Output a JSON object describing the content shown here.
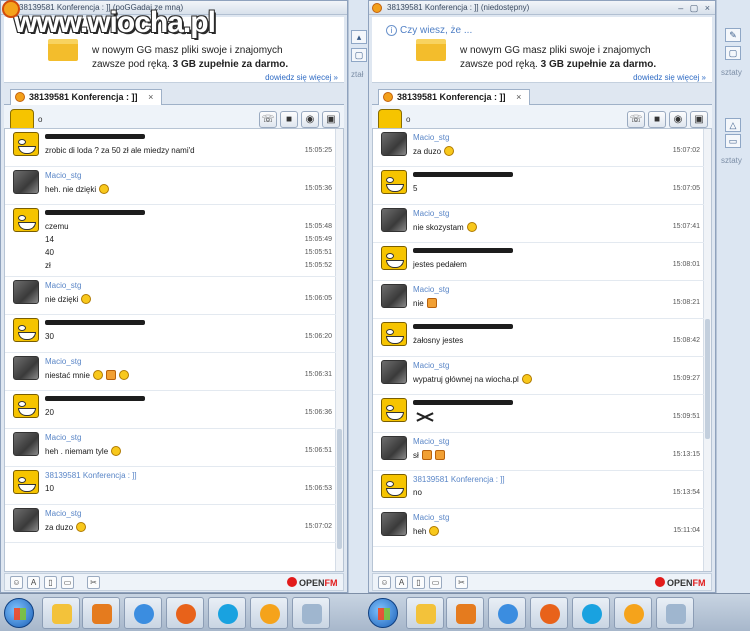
{
  "logo": {
    "text": "www.wiocha.pl"
  },
  "left_window": {
    "title": "38139581 Konferencja : ]] (poGGadaj ze mną)",
    "banner": {
      "line1": "w nowym GG masz pliki swoje i znajomych",
      "line2_pre": "zawsze pod ręką. ",
      "line2_bold": "3 GB zupełnie za darmo.",
      "more_link": "dowiedz się więcej »"
    },
    "tab_label": "38139581 Konferencja : ]]",
    "tab_close": "×",
    "status": "o",
    "messages": [
      {
        "avatar": "smile",
        "nick": "",
        "censored": true,
        "lines": [
          {
            "text": "zrobic di loda ? za 50 zł ale miedzy nami'd",
            "time": "15:05:25"
          }
        ]
      },
      {
        "avatar": "photo",
        "nick": "Macio_stg",
        "censored": false,
        "lines": [
          {
            "text": "heh. nie dzięki",
            "time": "15:05:36",
            "emo": [
              "round"
            ]
          }
        ]
      },
      {
        "avatar": "smile",
        "nick": "",
        "censored": true,
        "lines": [
          {
            "text": "czemu",
            "time": "15:05:48"
          },
          {
            "text": "14",
            "time": "15:05:49"
          },
          {
            "text": "40",
            "time": "15:05:51"
          },
          {
            "text": "zł",
            "time": "15:05:52"
          }
        ]
      },
      {
        "avatar": "photo",
        "nick": "Macio_stg",
        "censored": false,
        "lines": [
          {
            "text": "nie dzięki",
            "time": "15:06:05",
            "emo": [
              "round"
            ]
          }
        ]
      },
      {
        "avatar": "smile",
        "nick": "",
        "censored": true,
        "lines": [
          {
            "text": "30",
            "time": "15:06:20"
          }
        ]
      },
      {
        "avatar": "photo",
        "nick": "Macio_stg",
        "censored": false,
        "lines": [
          {
            "text": "niestać mnie",
            "time": "15:06:31",
            "emo": [
              "round",
              "sq",
              "round"
            ]
          }
        ]
      },
      {
        "avatar": "smile",
        "nick": "",
        "censored": true,
        "lines": [
          {
            "text": "20",
            "time": "15:06:36"
          }
        ]
      },
      {
        "avatar": "photo",
        "nick": "Macio_stg",
        "censored": false,
        "lines": [
          {
            "text": "heh . niemam tyle",
            "time": "15:06:51",
            "emo": [
              "round"
            ]
          }
        ]
      },
      {
        "avatar": "smile",
        "nick": "38139581 Konferencja : ]]",
        "censored": false,
        "lines": [
          {
            "text": "10",
            "time": "15:06:53"
          }
        ]
      },
      {
        "avatar": "photo",
        "nick": "Macio_stg",
        "censored": false,
        "lines": [
          {
            "text": "za duzo",
            "time": "15:07:02",
            "emo": [
              "round"
            ]
          }
        ]
      }
    ]
  },
  "right_window": {
    "title": "38139581 Konferencja : ]] (niedostępny)",
    "banner": {
      "tip": "Czy wiesz, że ...",
      "line1": "w nowym GG masz pliki swoje i znajomych",
      "line2_pre": "zawsze pod ręką. ",
      "line2_bold": "3 GB zupełnie za darmo.",
      "more_link": "dowiedz się więcej »"
    },
    "tab_label": "38139581 Konferencja : ]]",
    "tab_close": "×",
    "status": "o",
    "messages": [
      {
        "avatar": "photo",
        "nick": "Macio_stg",
        "censored": false,
        "lines": [
          {
            "text": "za duzo",
            "time": "15:07:02",
            "emo": [
              "round"
            ]
          }
        ]
      },
      {
        "avatar": "smile",
        "nick": "",
        "censored": true,
        "lines": [
          {
            "text": "5",
            "time": "15:07:05"
          }
        ]
      },
      {
        "avatar": "photo",
        "nick": "Macio_stg",
        "censored": false,
        "lines": [
          {
            "text": "nie skozystam",
            "time": "15:07:41",
            "emo": [
              "round"
            ]
          }
        ]
      },
      {
        "avatar": "smile",
        "nick": "",
        "censored": true,
        "lines": [
          {
            "text": "jestes pedałem",
            "time": "15:08:01"
          }
        ]
      },
      {
        "avatar": "photo",
        "nick": "Macio_stg",
        "censored": false,
        "lines": [
          {
            "text": "nie",
            "time": "15:08:21",
            "emo": [
              "sq"
            ]
          }
        ]
      },
      {
        "avatar": "smile",
        "nick": "",
        "censored": true,
        "lines": [
          {
            "text": "żałosny jestes",
            "time": "15:08:42"
          }
        ]
      },
      {
        "avatar": "photo",
        "nick": "Macio_stg",
        "censored": false,
        "lines": [
          {
            "text": "wypatruj głównej na wiocha.pl",
            "time": "15:09:27",
            "emo": [
              "round"
            ]
          }
        ]
      },
      {
        "avatar": "smile",
        "nick": "",
        "censored": true,
        "lines": [
          {
            "text": "",
            "time": "15:09:51",
            "emo": [
              "cross"
            ]
          }
        ]
      },
      {
        "avatar": "photo",
        "nick": "Macio_stg",
        "censored": false,
        "lines": [
          {
            "text": "sł",
            "time": "15:13:15",
            "emo": [
              "sq",
              "sq"
            ]
          }
        ]
      },
      {
        "avatar": "smile",
        "nick": "38139581 Konferencja : ]]",
        "censored": false,
        "lines": [
          {
            "text": "no",
            "time": "15:13:54"
          }
        ]
      },
      {
        "avatar": "photo",
        "nick": "Macio_stg",
        "censored": false,
        "lines": [
          {
            "text": "heh",
            "time": "15:11:04",
            "emo": [
              "round"
            ]
          }
        ]
      }
    ]
  },
  "openfm": {
    "open": "OPEN",
    "fm": "FM"
  },
  "toolbar_icons": [
    "phone-icon",
    "video-icon",
    "gamepad-icon",
    "gift-icon"
  ],
  "bottom_icons": [
    "emoticon-icon",
    "font-icon",
    "file-icon",
    "image-icon",
    "scissors-icon"
  ],
  "taskbar_apps": [
    "explorer-icon",
    "media-player-icon",
    "ie-icon",
    "firefox-icon",
    "skype-icon",
    "gadu-gadu-icon",
    "paint-icon"
  ],
  "strip_right": {
    "label1": "sztaty",
    "label2": "sztaty"
  },
  "strip_left": {
    "label": "ztał"
  },
  "colors": {
    "nick": "#5a86c7",
    "banner_link": "#2f6bc4",
    "openfm_red": "#e21b1b",
    "gg_sun": "#f3a01b"
  }
}
